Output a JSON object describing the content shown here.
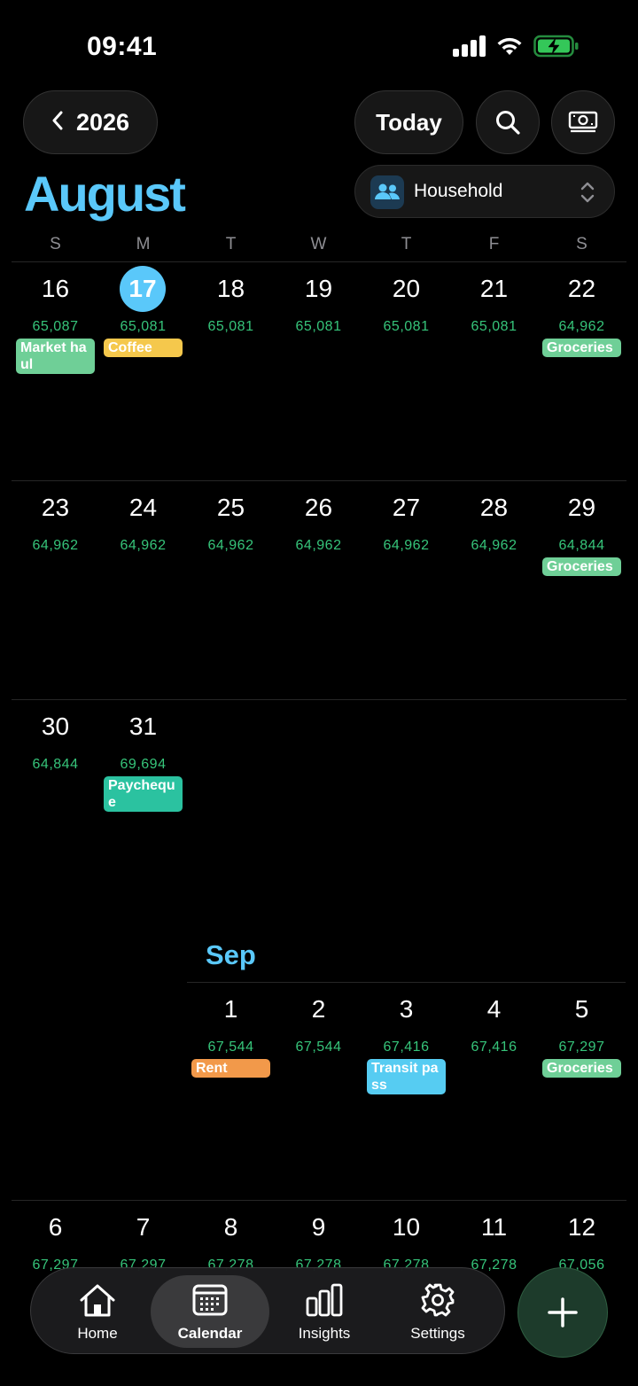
{
  "status_bar": {
    "time": "09:41"
  },
  "header": {
    "year_label": "2026",
    "today_label": "Today",
    "month_title": "August",
    "account_selector": "Household"
  },
  "weekdays": [
    "S",
    "M",
    "T",
    "W",
    "T",
    "F",
    "S"
  ],
  "colors": {
    "accent": "#5ac8fa",
    "balance_text": "#36c47a",
    "groceries": "#6fcf97",
    "coffee": "#f5c84c",
    "paycheque": "#2bc2a0",
    "rent": "#f2994a",
    "transit": "#56ccf2"
  },
  "august": {
    "weeks": [
      [
        {
          "day": "16",
          "balance": "65,087",
          "event": {
            "label": "Market haul",
            "color": "#6fcf97"
          }
        },
        {
          "day": "17",
          "balance": "65,081",
          "today": true,
          "event": {
            "label": "Coffee",
            "color": "#f5c84c"
          }
        },
        {
          "day": "18",
          "balance": "65,081"
        },
        {
          "day": "19",
          "balance": "65,081"
        },
        {
          "day": "20",
          "balance": "65,081"
        },
        {
          "day": "21",
          "balance": "65,081"
        },
        {
          "day": "22",
          "balance": "64,962",
          "event": {
            "label": "Groceries",
            "color": "#6fcf97"
          }
        }
      ],
      [
        {
          "day": "23",
          "balance": "64,962"
        },
        {
          "day": "24",
          "balance": "64,962"
        },
        {
          "day": "25",
          "balance": "64,962"
        },
        {
          "day": "26",
          "balance": "64,962"
        },
        {
          "day": "27",
          "balance": "64,962"
        },
        {
          "day": "28",
          "balance": "64,962"
        },
        {
          "day": "29",
          "balance": "64,844",
          "event": {
            "label": "Groceries",
            "color": "#6fcf97"
          }
        }
      ],
      [
        {
          "day": "30",
          "balance": "64,844"
        },
        {
          "day": "31",
          "balance": "69,694",
          "event": {
            "label": "Paycheque",
            "color": "#2bc2a0"
          }
        }
      ]
    ]
  },
  "september": {
    "label": "Sep",
    "weeks": [
      [
        {
          "day": "1",
          "balance": "67,544",
          "event": {
            "label": "Rent",
            "color": "#f2994a"
          }
        },
        {
          "day": "2",
          "balance": "67,544"
        },
        {
          "day": "3",
          "balance": "67,416",
          "event": {
            "label": "Transit pass",
            "color": "#56ccf2"
          }
        },
        {
          "day": "4",
          "balance": "67,416"
        },
        {
          "day": "5",
          "balance": "67,297",
          "event": {
            "label": "Groceries",
            "color": "#6fcf97"
          }
        }
      ],
      [
        {
          "day": "6",
          "balance": "67,297"
        },
        {
          "day": "7",
          "balance": "67,297"
        },
        {
          "day": "8",
          "balance": "67,278"
        },
        {
          "day": "9",
          "balance": "67,278"
        },
        {
          "day": "10",
          "balance": "67,278"
        },
        {
          "day": "11",
          "balance": "67,278"
        },
        {
          "day": "12",
          "balance": "67,056"
        }
      ]
    ]
  },
  "tabbar": {
    "tabs": [
      {
        "label": "Home",
        "icon": "house-icon"
      },
      {
        "label": "Calendar",
        "icon": "calendar-icon",
        "active": true
      },
      {
        "label": "Insights",
        "icon": "bar-chart-icon"
      },
      {
        "label": "Settings",
        "icon": "gear-icon"
      }
    ],
    "add_icon": "plus-icon"
  }
}
